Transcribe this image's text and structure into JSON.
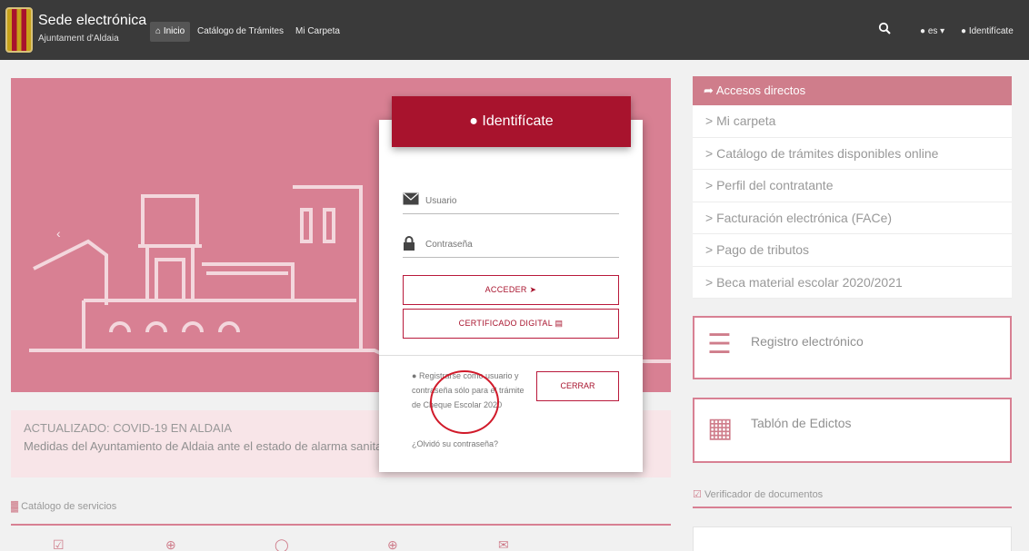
{
  "header": {
    "title": "Sede electrónica",
    "subtitle": "Ajuntament d'Aldaia",
    "nav": [
      {
        "label": "Inicio",
        "icon": "home-icon"
      },
      {
        "label": "Catálogo de Trámites"
      },
      {
        "label": "Mi Carpeta"
      }
    ],
    "search_icon": "search-icon",
    "language": "es",
    "identify_label": "Identifícate"
  },
  "covid": {
    "title": "ACTUALIZADO: COVID-19 EN ALDAIA",
    "text": "Medidas del Ayuntamiento de Aldaia ante el estado de alarma sanitaria"
  },
  "catalog": {
    "title": "Catálogo de servicios"
  },
  "accesos": {
    "title": "Accesos directos",
    "items": [
      "Mi carpeta",
      "Catálogo de trámites disponibles online",
      "Perfil del contratante",
      "Facturación electrónica (FACe)",
      "Pago de tributos",
      "Beca material escolar 2020/2021"
    ]
  },
  "cards": {
    "registro": "Registro electrónico",
    "tablon": "Tablón de Edictos",
    "verificador": "Verificador de documentos"
  },
  "modal": {
    "title": "Identifícate",
    "usuario_placeholder": "Usuario",
    "password_placeholder": "Contraseña",
    "acceder_label": "ACCEDER",
    "certificado_label": "CERTIFICADO DIGITAL",
    "register_text": "Registrarse como usuario y contraseña sólo para el trámite de Cheque Escolar 2020",
    "cerrar_label": "CERRAR",
    "forgot_label": "¿Olvidó su contraseña?"
  },
  "colors": {
    "brand": "#a8132d",
    "navbar": "#3a3a3a",
    "annotation": "#d11a2a"
  }
}
